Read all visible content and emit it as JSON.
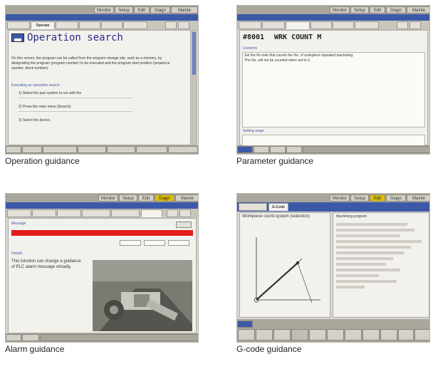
{
  "captions": [
    "Operation guidance",
    "Parameter guidance",
    "Alarm guidance",
    "G-code guidance"
  ],
  "screens": [
    {
      "topbar": [
        "Monitor",
        "Setup",
        "Edit",
        "Diagn",
        "Mainte"
      ],
      "tabs": [
        "Operate"
      ],
      "heading": "Operation search",
      "body": [
        "On this screen, the program can be called from the program storage site, such as a memory, by designating the program (program number) to be executed and the program start position (sequence number, block number).",
        "Executing an operation search",
        "1) Select the part system to run with the",
        "2) Press the main menu [Search].",
        "3) Select the device."
      ]
    },
    {
      "topbar": [
        "Monitor",
        "Setup",
        "Edit",
        "Diagn",
        "Mainte"
      ],
      "param_no": "#8001",
      "param_name": "WRK COUNT M",
      "contents_label": "Contents",
      "contents": [
        "Set the M-code that counts the No. of workpiece repeated machining.",
        "The No. will not be counted when set to 0."
      ],
      "setting_range_label": "Setting range"
    },
    {
      "topbar": [
        "Monitor",
        "Setup",
        "Edit",
        "Diagn",
        "Mainte"
      ],
      "message_label": "Message",
      "alarm_line": "",
      "details_label": "Details",
      "details": "This function can change a guidance of PLC alarm message virtually."
    },
    {
      "topbar": [
        "Monitor",
        "Setup",
        "Edit",
        "Diagn",
        "Mainte"
      ],
      "tabs": [
        "G-Code"
      ],
      "left_title": "Workpiece coord.system (selection)",
      "right_title": "Machining program"
    }
  ]
}
